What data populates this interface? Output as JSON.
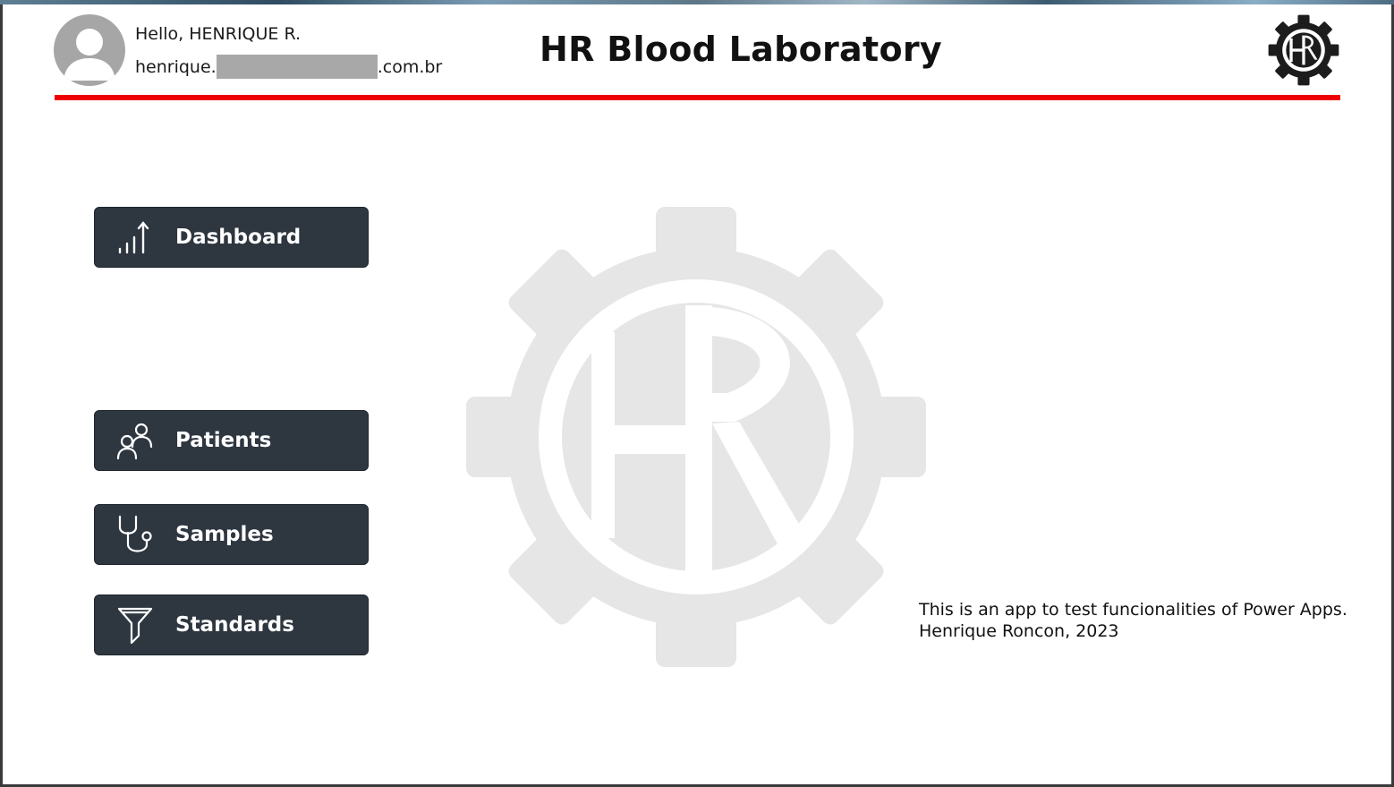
{
  "user": {
    "greeting": "Hello, HENRIQUE R.",
    "email_prefix": "henrique.",
    "email_suffix": ".com.br"
  },
  "header": {
    "title": "HR Blood Laboratory",
    "accent_color": "#ee0000"
  },
  "nav": {
    "dashboard_label": "Dashboard",
    "patients_label": "Patients",
    "samples_label": "Samples",
    "standards_label": "Standards",
    "button_color": "#2e3640"
  },
  "footer": {
    "line1": "This is an app to test funcionalities of Power Apps.",
    "line2": "Henrique Roncon, 2023"
  },
  "icons": {
    "avatar": "person-silhouette-icon",
    "logo": "hr-gear-logo-icon",
    "dashboard": "bar-chart-up-icon",
    "patients": "people-icon",
    "samples": "stethoscope-icon",
    "standards": "funnel-icon"
  }
}
